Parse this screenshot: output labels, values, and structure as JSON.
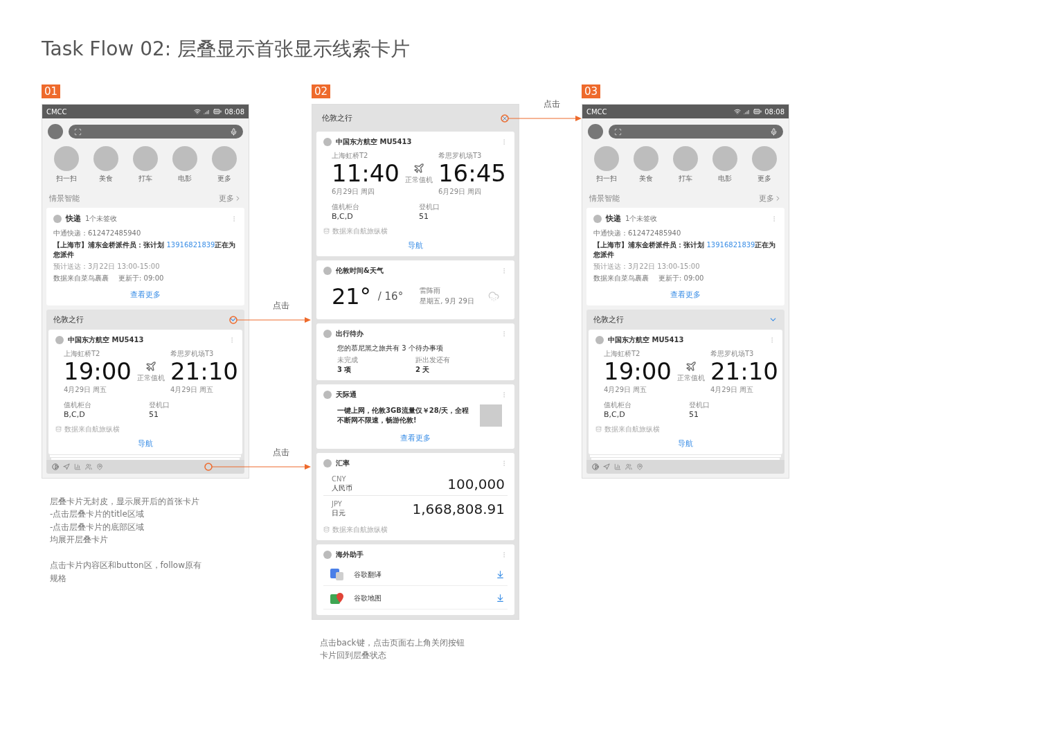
{
  "title": "Task Flow 02: 层叠显示首张显示线索卡片",
  "steps": [
    {
      "badge": "01",
      "screen": {
        "kind": "home",
        "status_bar": {
          "carrier": "CMCC",
          "time": "08:08"
        },
        "shortcuts": [
          "扫一扫",
          "美食",
          "打车",
          "电影",
          "更多"
        ],
        "section": {
          "title": "情景智能",
          "more": "更多"
        },
        "express": {
          "title": "快递",
          "badge": "1个未签收",
          "tracking": "中通快递：612472485940",
          "message": {
            "before": "【上海市】浦东金桥派件员：张计划 ",
            "phone": "13916821839",
            "after": "正在为您派件"
          },
          "eta": "预计送达：3月22日   13:00-15:00",
          "source": "数据来自菜鸟裹裹",
          "updated": "更新于: 09:00",
          "link": "查看更多"
        },
        "stack": {
          "title": "伦敦之行",
          "flight": {
            "airline": "中国东方航空 MU5413",
            "from": {
              "airport": "上海虹桥T2",
              "time": "19:00",
              "date": "4月29日 周五"
            },
            "to": {
              "airport": "希思罗机场T3",
              "time": "21:10",
              "date": "4月29日 周五"
            },
            "status": "正常值机",
            "counter": {
              "label": "值机柜台",
              "value": "B,C,D"
            },
            "gate": {
              "label": "登机口",
              "value": "51"
            },
            "source": "数据来自航旅纵横",
            "action": "导航"
          }
        },
        "title_tap": "点击",
        "bottom_tap": "点击"
      },
      "note": [
        {
          "lines": [
            "层叠卡片无封皮，显示展开后的首张卡片",
            "-点击层叠卡片的title区域",
            "-点击层叠卡片的底部区域",
            "均展开层叠卡片"
          ]
        },
        {
          "lines": [
            "点击卡片内容区和button区，follow原有规格"
          ]
        }
      ]
    },
    {
      "badge": "02",
      "screen": {
        "kind": "stack_page",
        "title": "伦敦之行",
        "cards": [
          {
            "kind": "flight",
            "airline": "中国东方航空 MU5413",
            "from": {
              "airport": "上海虹桥T2",
              "time": "11:40",
              "date": "6月29日 周四"
            },
            "to": {
              "airport": "希思罗机场T3",
              "time": "16:45",
              "date": "6月29日 周四"
            },
            "status": "正常值机",
            "counter": {
              "label": "值机柜台",
              "value": "B,C,D"
            },
            "gate": {
              "label": "登机口",
              "value": "51"
            },
            "source": "数据来自航旅纵横",
            "action": "导航"
          },
          {
            "kind": "weather",
            "title": "伦敦时间&天气",
            "high": "21°",
            "low": "/ 16°",
            "condition": "雷阵雨",
            "date": "星期五, 9月 29日"
          },
          {
            "kind": "todo",
            "title": "出行待办",
            "summary": "您的慕尼黑之旅共有 3 个待办事项",
            "stats": [
              {
                "label": "未完成",
                "value": "3 项"
              },
              {
                "label": "距出发还有",
                "value": "2 天"
              }
            ]
          },
          {
            "kind": "promo",
            "title": "天际通",
            "text": "一键上网，伦敦3GB流量仅￥28/天，全程不断网不限速，畅游伦敦!",
            "link": "查看更多"
          },
          {
            "kind": "exchange",
            "title": "汇率",
            "rows": [
              {
                "code": "CNY",
                "name": "人民币",
                "amount": "100,000"
              },
              {
                "code": "JPY",
                "name": "日元",
                "amount": "1,668,808.91"
              }
            ],
            "source": "数据来自航旅纵横"
          },
          {
            "kind": "apps",
            "title": "海外助手",
            "apps": [
              {
                "name": "谷歌翻译"
              },
              {
                "name": "谷歌地图"
              }
            ]
          }
        ],
        "close_tap": "点击"
      },
      "note": [
        {
          "lines": [
            "点击back键，点击页面右上角关闭按钮",
            "卡片回到层叠状态"
          ]
        }
      ]
    },
    {
      "badge": "03",
      "screen": {
        "kind": "home",
        "status_bar": {
          "carrier": "CMCC",
          "time": "08:08"
        },
        "shortcuts": [
          "扫一扫",
          "美食",
          "打车",
          "电影",
          "更多"
        ],
        "section": {
          "title": "情景智能",
          "more": "更多"
        },
        "express": {
          "title": "快递",
          "badge": "1个未签收",
          "tracking": "中通快递：612472485940",
          "message": {
            "before": "【上海市】浦东金桥派件员：张计划 ",
            "phone": "13916821839",
            "after": "正在为您派件"
          },
          "eta": "预计送达：3月22日   13:00-15:00",
          "source": "数据来自菜鸟裹裹",
          "updated": "更新于: 09:00",
          "link": "查看更多"
        },
        "stack": {
          "title": "伦敦之行",
          "flight": {
            "airline": "中国东方航空 MU5413",
            "from": {
              "airport": "上海虹桥T2",
              "time": "19:00",
              "date": "4月29日 周五"
            },
            "to": {
              "airport": "希思罗机场T3",
              "time": "21:10",
              "date": "4月29日 周五"
            },
            "status": "正常值机",
            "counter": {
              "label": "值机柜台",
              "value": "B,C,D"
            },
            "gate": {
              "label": "登机口",
              "value": "51"
            },
            "source": "数据来自航旅纵横",
            "action": "导航"
          }
        }
      }
    }
  ]
}
